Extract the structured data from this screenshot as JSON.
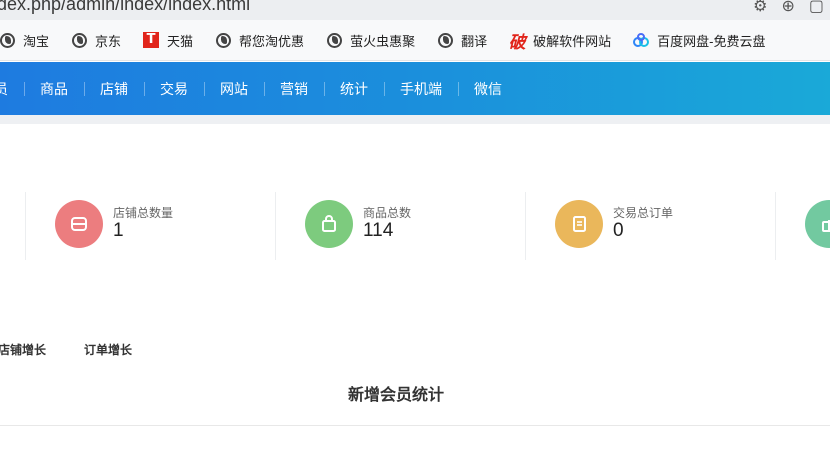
{
  "browser": {
    "url": "dex.php/admin/index/index.html",
    "bookmarks": [
      {
        "label": "淘宝",
        "icon": "globe-icon"
      },
      {
        "label": "京东",
        "icon": "globe-icon"
      },
      {
        "label": "天猫",
        "icon": "tmall-icon"
      },
      {
        "label": "帮您淘优惠",
        "icon": "globe-icon"
      },
      {
        "label": "萤火虫惠聚",
        "icon": "globe-icon"
      },
      {
        "label": "翻译",
        "icon": "globe-icon"
      },
      {
        "label": "破解软件网站",
        "icon": "poji-icon"
      },
      {
        "label": "百度网盘-免费云盘",
        "icon": "baidu-netdisk-icon"
      }
    ]
  },
  "nav": {
    "items": [
      "员",
      "商品",
      "店铺",
      "交易",
      "网站",
      "营销",
      "统计",
      "手机端",
      "微信"
    ],
    "brand_color_start": "#1e7be0",
    "brand_color_end": "#1aa9d8"
  },
  "stats": [
    {
      "label": "店铺总数量",
      "value": "1",
      "color": "#ec7d7f",
      "icon": "store-icon"
    },
    {
      "label": "商品总数",
      "value": "114",
      "color": "#7dcb7e",
      "icon": "shopping-bag-icon"
    },
    {
      "label": "交易总订单",
      "value": "0",
      "color": "#eab75b",
      "icon": "document-icon"
    },
    {
      "label": "",
      "value": "",
      "color": "#72c9a0",
      "icon": "gift-icon"
    }
  ],
  "tabs": [
    "店铺增长",
    "订单增长"
  ],
  "chart": {
    "title": "新增会员统计"
  }
}
